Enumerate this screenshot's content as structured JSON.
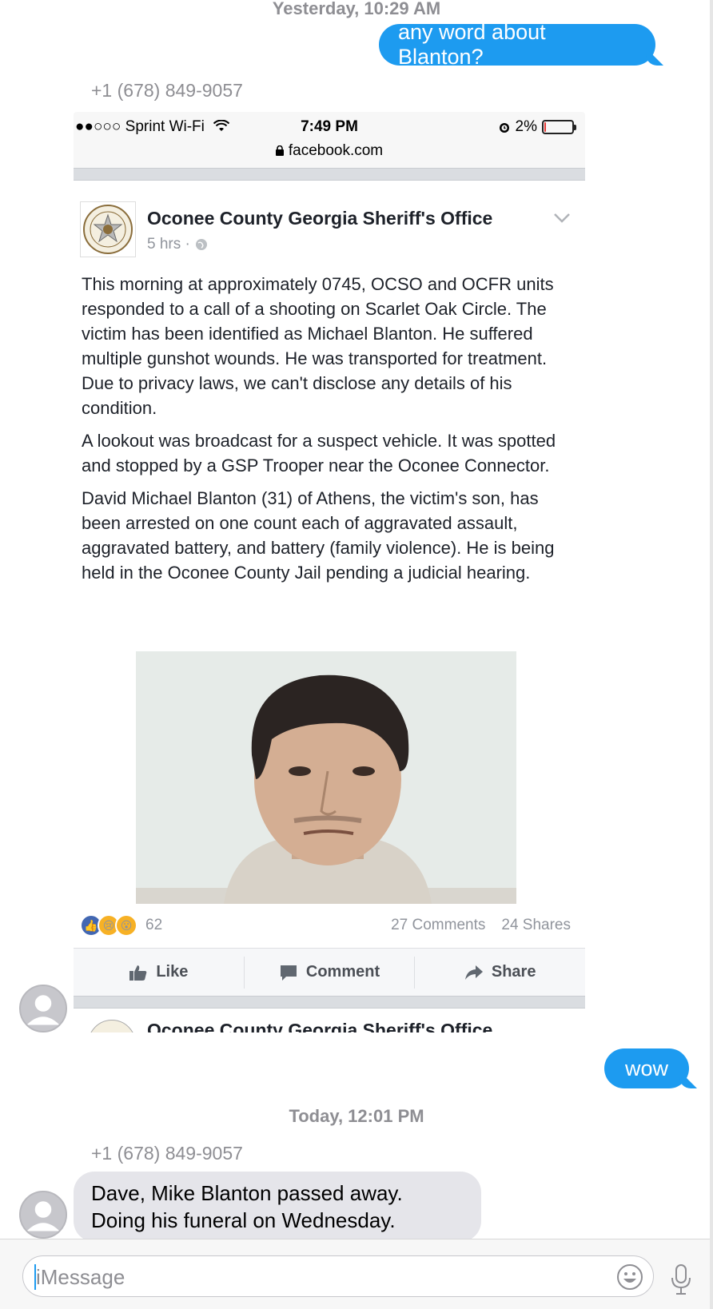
{
  "thread": {
    "timestamp_1": "Yesterday, 10:29 AM",
    "timestamp_2": "Today, 12:01 PM",
    "sender": "+1 (678) 849-9057",
    "msg_out_1": "any word about Blanton?",
    "msg_out_2": "wow",
    "msg_in_1_line1": "Dave, Mike Blanton passed away.",
    "msg_in_1_line2": "Doing his funeral on Wednesday."
  },
  "screenshot": {
    "status": {
      "carrier": "●●○○○ Sprint Wi-Fi",
      "time": "7:49 PM",
      "battery": "2%",
      "battery_level": 0.02,
      "url": "facebook.com"
    },
    "post": {
      "author": "Oconee County Georgia Sheriff's Office",
      "age": "5 hrs ·",
      "paragraphs": [
        "This morning at approximately 0745, OCSO and OCFR units responded to a call of a shooting on Scarlet Oak Circle. The victim has been identified as Michael Blanton. He suffered multiple gunshot wounds. He was transported for treatment. Due to privacy laws, we can't disclose any details of his condition.",
        "A lookout was broadcast for a suspect vehicle. It was spotted and stopped by a GSP Trooper near the Oconee Connector.",
        "David Michael Blanton (31) of Athens, the victim's son, has been arrested on one count each of aggravated assault, aggravated battery, and battery (family violence). He is being held in the Oconee County Jail pending a judicial hearing."
      ],
      "reactions_count": "62",
      "comments": "27 Comments",
      "shares": "24 Shares",
      "actions": {
        "like": "Like",
        "comment": "Comment",
        "share": "Share"
      }
    },
    "next_post_author": "Oconee County Georgia Sheriff's Office"
  },
  "composer": {
    "placeholder": "iMessage"
  },
  "colors": {
    "outgoing_bubble": "#1d9bf0",
    "incoming_bubble": "#e5e5ea",
    "facebook_blue": "#4267b2"
  }
}
